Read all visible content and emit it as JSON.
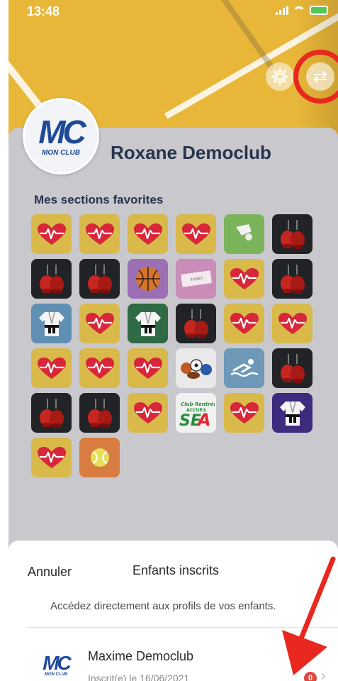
{
  "status_bar": {
    "time": "13:48"
  },
  "header": {
    "user_name": "Roxane  Democlub",
    "logo_text_main": "MC",
    "logo_text_sub": "MON CLUB"
  },
  "favorites": {
    "title": "Mes sections favorites",
    "tiles": [
      {
        "icon": "heart-icon",
        "style": "t-heart"
      },
      {
        "icon": "heart-icon",
        "style": "t-heart"
      },
      {
        "icon": "heart-icon",
        "style": "t-heart"
      },
      {
        "icon": "heart-icon",
        "style": "t-heart"
      },
      {
        "icon": "badminton-icon",
        "style": "t-green"
      },
      {
        "icon": "boxing-gloves-icon",
        "style": "t-dark"
      },
      {
        "icon": "boxing-gloves-icon",
        "style": "t-dark"
      },
      {
        "icon": "boxing-gloves-icon",
        "style": "t-dark"
      },
      {
        "icon": "basketball-icon",
        "style": "t-purple"
      },
      {
        "icon": "ticket-icon",
        "style": "t-pink"
      },
      {
        "icon": "heart-icon",
        "style": "t-heart"
      },
      {
        "icon": "boxing-gloves-icon",
        "style": "t-dark"
      },
      {
        "icon": "judo-gi-icon",
        "style": "t-blue"
      },
      {
        "icon": "heart-icon",
        "style": "t-heart"
      },
      {
        "icon": "judo-gi-icon",
        "style": "t-dkgreen"
      },
      {
        "icon": "boxing-gloves-icon",
        "style": "t-dark"
      },
      {
        "icon": "heart-icon",
        "style": "t-heart"
      },
      {
        "icon": "heart-icon",
        "style": "t-heart"
      },
      {
        "icon": "heart-icon",
        "style": "t-heart"
      },
      {
        "icon": "heart-icon",
        "style": "t-heart"
      },
      {
        "icon": "heart-icon",
        "style": "t-heart"
      },
      {
        "icon": "sports-balls-icon",
        "style": "t-white"
      },
      {
        "icon": "swimmer-icon",
        "style": "t-sky"
      },
      {
        "icon": "boxing-gloves-icon",
        "style": "t-dark"
      },
      {
        "icon": "boxing-gloves-icon",
        "style": "t-dark"
      },
      {
        "icon": "boxing-gloves-icon",
        "style": "t-dark"
      },
      {
        "icon": "heart-icon",
        "style": "t-heart"
      },
      {
        "icon": "accueil-logo-icon",
        "style": "t-accueil"
      },
      {
        "icon": "heart-icon",
        "style": "t-heart"
      },
      {
        "icon": "judo-gi-icon",
        "style": "t-indigo"
      },
      {
        "icon": "heart-icon",
        "style": "t-heart"
      },
      {
        "icon": "tennis-ball-icon",
        "style": "t-orange"
      }
    ]
  },
  "sheet": {
    "cancel_label": "Annuler",
    "title": "Enfants inscrits",
    "description": "Accédez directement aux profils de vos enfants.",
    "children": [
      {
        "name": "Maxime Democlub",
        "subtitle": "Inscrit(e) le 16/06/2021",
        "badge_count": "0",
        "logo_text_main": "MC",
        "logo_text_sub": "MON CLUB"
      }
    ]
  },
  "colors": {
    "accent_red": "#e8271e",
    "title_navy": "#26344e",
    "brand_blue": "#1e4a98"
  }
}
